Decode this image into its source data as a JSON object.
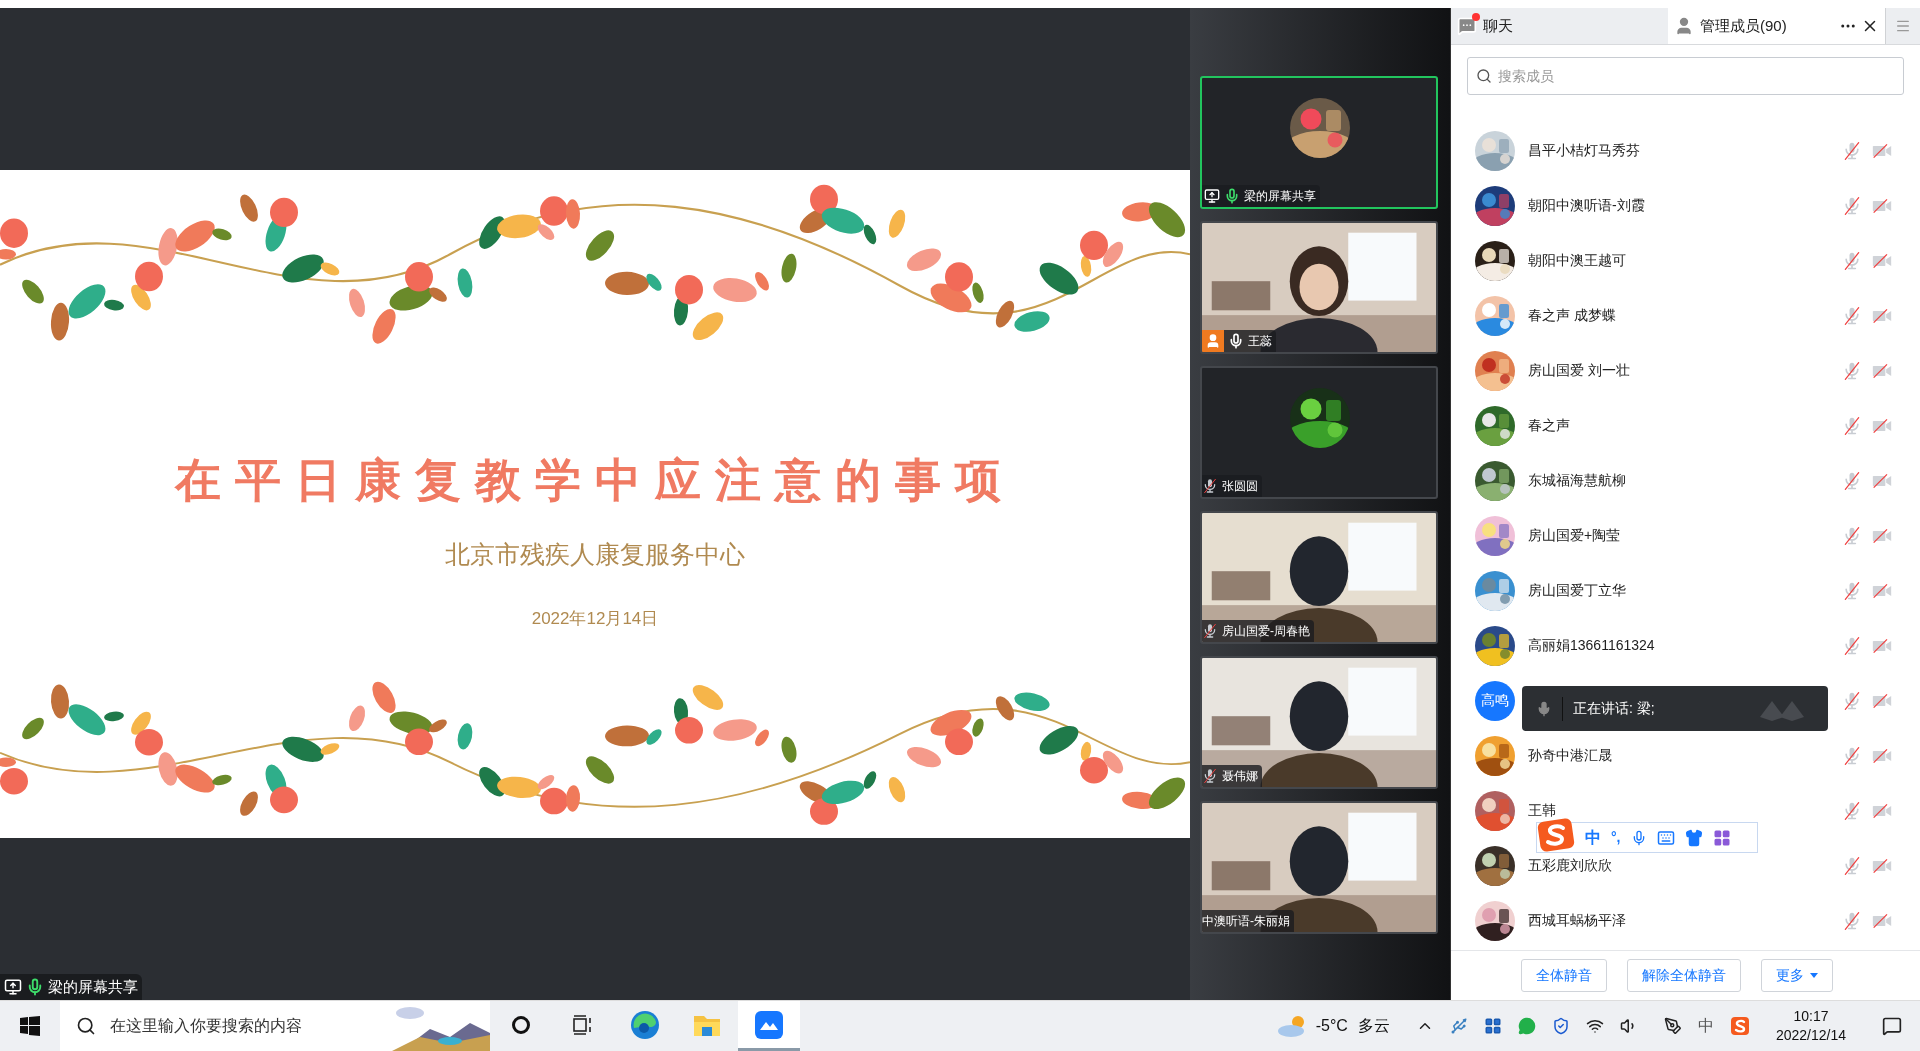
{
  "stage": {
    "slide": {
      "title": "在平日康复教学中应注意的事项",
      "subtitle": "北京市残疾人康复服务中心",
      "date": "2022年12月14日"
    },
    "share_label": {
      "text": "梁的屏幕共享",
      "talking": true
    }
  },
  "video_tiles": [
    {
      "name": "梁的屏幕共享",
      "kind": "avatar",
      "sharing": true,
      "host": false,
      "muted": false,
      "talking": true,
      "speaking": true
    },
    {
      "name": "王蕊",
      "kind": "video",
      "sharing": false,
      "host": true,
      "muted": false,
      "talking": false,
      "speaking": false
    },
    {
      "name": "张圆圆",
      "kind": "avatar",
      "sharing": false,
      "host": false,
      "muted": true,
      "talking": false,
      "speaking": false
    },
    {
      "name": "房山国爱-周春艳",
      "kind": "video",
      "sharing": false,
      "host": false,
      "muted": true,
      "talking": false,
      "speaking": false
    },
    {
      "name": "聂伟娜",
      "kind": "video",
      "sharing": false,
      "host": false,
      "muted": true,
      "talking": false,
      "speaking": false
    },
    {
      "name": "中澳听语-朱丽娟",
      "kind": "video",
      "sharing": false,
      "host": false,
      "speaking": false
    }
  ],
  "panel": {
    "tabs": [
      {
        "label": "聊天",
        "selected": false,
        "unread": true
      },
      {
        "label": "管理成员(90)",
        "selected": true,
        "unread": false
      }
    ],
    "search": {
      "placeholder": "搜索成员"
    },
    "members": [
      {
        "name": "昌平小桔灯马秀芬",
        "muted": true,
        "video_off": true
      },
      {
        "name": "朝阳中澳听语-刘霞",
        "muted": true,
        "video_off": true
      },
      {
        "name": "朝阳中澳王越可",
        "muted": true,
        "video_off": true
      },
      {
        "name": "春之声 成梦蝶",
        "muted": true,
        "video_off": true
      },
      {
        "name": "房山国爱 刘一壮",
        "muted": true,
        "video_off": true
      },
      {
        "name": "春之声",
        "muted": true,
        "video_off": true
      },
      {
        "name": "东城福海慧航柳",
        "muted": true,
        "video_off": true
      },
      {
        "name": "房山国爱+陶莹",
        "muted": true,
        "video_off": true
      },
      {
        "name": "房山国爱丁立华",
        "muted": true,
        "video_off": true
      },
      {
        "name": "高丽娟13661161324",
        "muted": true,
        "video_off": true
      },
      {
        "avatar_text": "高鸣",
        "muted": true,
        "video_off": true
      },
      {
        "name": "孙奇中港汇晟",
        "muted": true,
        "video_off": true
      },
      {
        "name": "王韩",
        "muted": true,
        "video_off": true
      },
      {
        "name": "五彩鹿刘欣欣",
        "muted": true,
        "video_off": true
      },
      {
        "name": "西城耳蜗杨平泽",
        "muted": true,
        "video_off": true
      }
    ],
    "speaking_toast": {
      "text": "正在讲话: 梁;"
    },
    "ime_toolbar": {
      "mode": "中",
      "punct": "°,"
    },
    "buttons": [
      "全体静音",
      "解除全体静音",
      "更多"
    ]
  },
  "taskbar": {
    "search": {
      "placeholder": "在这里输入你要搜索的内容"
    },
    "apps": [
      {
        "kind": "cortana",
        "selected": false
      },
      {
        "kind": "taskview",
        "selected": false
      },
      {
        "kind": "edge",
        "selected": false
      },
      {
        "kind": "explorer",
        "selected": false
      },
      {
        "kind": "meeting",
        "selected": true
      }
    ],
    "weather": {
      "temp": "-5°C",
      "condition": "多云"
    },
    "ime": "中",
    "time": "10:17",
    "date": "2022/12/14"
  }
}
